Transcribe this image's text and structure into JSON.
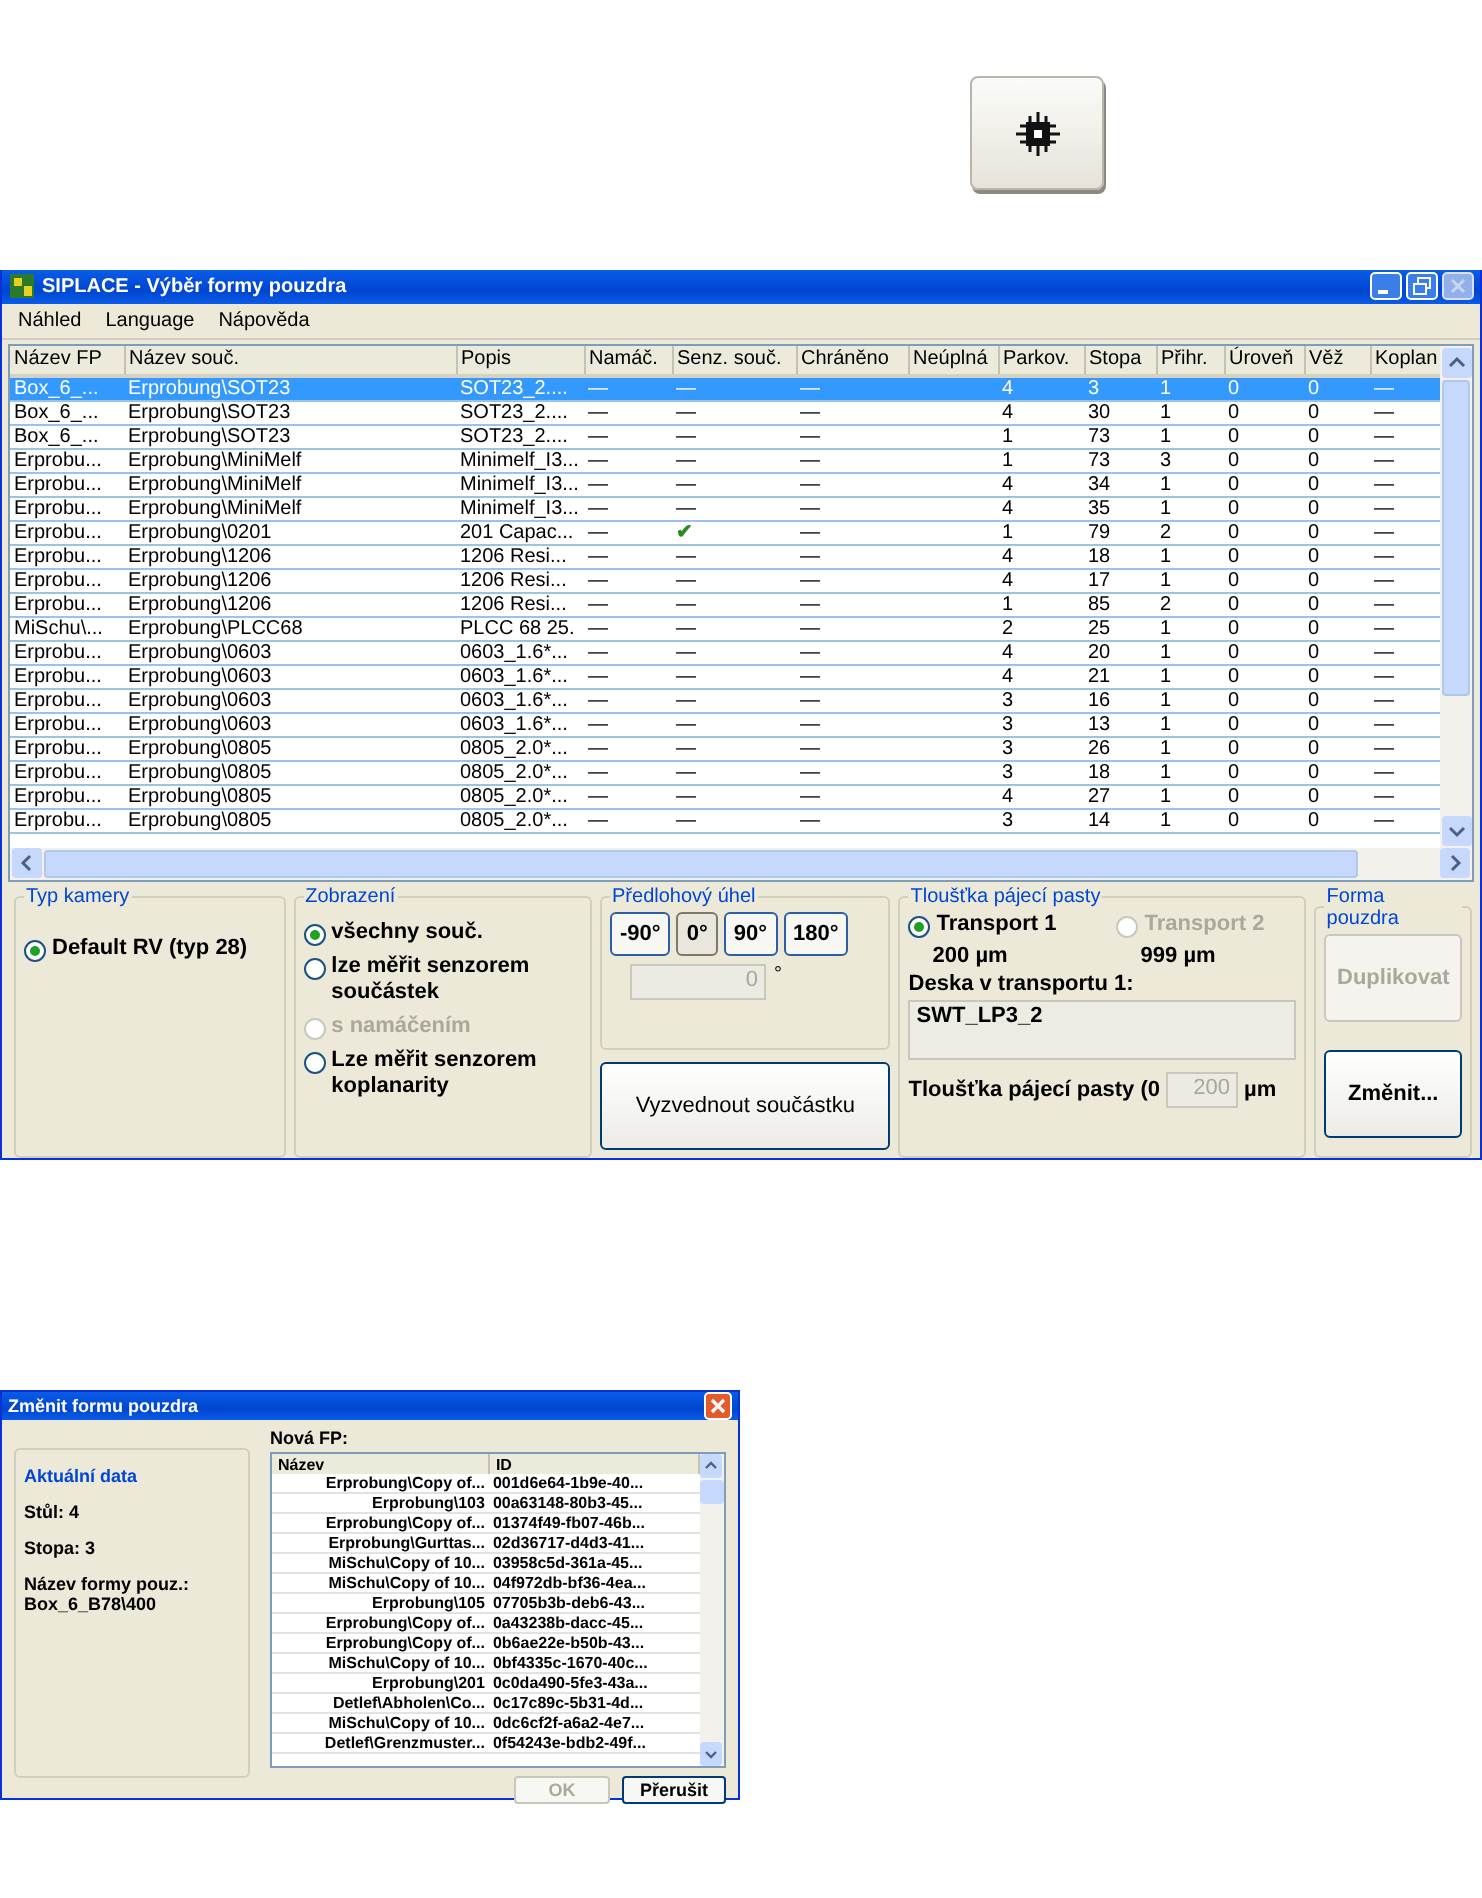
{
  "window": {
    "title": "SIPLACE - Výběr formy pouzdra"
  },
  "menu": [
    "Náhled",
    "Language",
    "Nápověda"
  ],
  "table": {
    "columns": [
      "Název FP",
      "Název souč.",
      "Popis",
      "Namáč.",
      "Senz. souč.",
      "Chráněno",
      "Neúplná",
      "Parkov.",
      "Stopa",
      "Přihr.",
      "Úroveň",
      "Věž",
      "Koplan"
    ],
    "rows": [
      {
        "selected": true,
        "sensor_ok": false,
        "cells": [
          "Box_6_...",
          "Erprobung\\SOT23",
          "SOT23_2....",
          "—",
          "—",
          "—",
          "",
          "4",
          "3",
          "1",
          "0",
          "0",
          "—"
        ]
      },
      {
        "selected": false,
        "sensor_ok": false,
        "cells": [
          "Box_6_...",
          "Erprobung\\SOT23",
          "SOT23_2....",
          "—",
          "—",
          "—",
          "",
          "4",
          "30",
          "1",
          "0",
          "0",
          "—"
        ]
      },
      {
        "selected": false,
        "sensor_ok": false,
        "cells": [
          "Box_6_...",
          "Erprobung\\SOT23",
          "SOT23_2....",
          "—",
          "—",
          "—",
          "",
          "1",
          "73",
          "1",
          "0",
          "0",
          "—"
        ]
      },
      {
        "selected": false,
        "sensor_ok": false,
        "cells": [
          "Erprobu...",
          "Erprobung\\MiniMelf",
          "Minimelf_I3...",
          "—",
          "—",
          "—",
          "",
          "1",
          "73",
          "3",
          "0",
          "0",
          "—"
        ]
      },
      {
        "selected": false,
        "sensor_ok": false,
        "cells": [
          "Erprobu...",
          "Erprobung\\MiniMelf",
          "Minimelf_I3...",
          "—",
          "—",
          "—",
          "",
          "4",
          "34",
          "1",
          "0",
          "0",
          "—"
        ]
      },
      {
        "selected": false,
        "sensor_ok": false,
        "cells": [
          "Erprobu...",
          "Erprobung\\MiniMelf",
          "Minimelf_I3...",
          "—",
          "—",
          "—",
          "",
          "4",
          "35",
          "1",
          "0",
          "0",
          "—"
        ]
      },
      {
        "selected": false,
        "sensor_ok": true,
        "cells": [
          "Erprobu...",
          "Erprobung\\0201",
          "201 Capac...",
          "—",
          "✔",
          "—",
          "",
          "1",
          "79",
          "2",
          "0",
          "0",
          "—"
        ]
      },
      {
        "selected": false,
        "sensor_ok": false,
        "cells": [
          "Erprobu...",
          "Erprobung\\1206",
          "1206 Resi...",
          "—",
          "—",
          "—",
          "",
          "4",
          "18",
          "1",
          "0",
          "0",
          "—"
        ]
      },
      {
        "selected": false,
        "sensor_ok": false,
        "cells": [
          "Erprobu...",
          "Erprobung\\1206",
          "1206 Resi...",
          "—",
          "—",
          "—",
          "",
          "4",
          "17",
          "1",
          "0",
          "0",
          "—"
        ]
      },
      {
        "selected": false,
        "sensor_ok": false,
        "cells": [
          "Erprobu...",
          "Erprobung\\1206",
          "1206 Resi...",
          "—",
          "—",
          "—",
          "",
          "1",
          "85",
          "2",
          "0",
          "0",
          "—"
        ]
      },
      {
        "selected": false,
        "sensor_ok": false,
        "cells": [
          "MiSchu\\...",
          "Erprobung\\PLCC68",
          "PLCC 68 25.",
          "—",
          "—",
          "—",
          "",
          "2",
          "25",
          "1",
          "0",
          "0",
          "—"
        ]
      },
      {
        "selected": false,
        "sensor_ok": false,
        "cells": [
          "Erprobu...",
          "Erprobung\\0603",
          "0603_1.6*...",
          "—",
          "—",
          "—",
          "",
          "4",
          "20",
          "1",
          "0",
          "0",
          "—"
        ]
      },
      {
        "selected": false,
        "sensor_ok": false,
        "cells": [
          "Erprobu...",
          "Erprobung\\0603",
          "0603_1.6*...",
          "—",
          "—",
          "—",
          "",
          "4",
          "21",
          "1",
          "0",
          "0",
          "—"
        ]
      },
      {
        "selected": false,
        "sensor_ok": false,
        "cells": [
          "Erprobu...",
          "Erprobung\\0603",
          "0603_1.6*...",
          "—",
          "—",
          "—",
          "",
          "3",
          "16",
          "1",
          "0",
          "0",
          "—"
        ]
      },
      {
        "selected": false,
        "sensor_ok": false,
        "cells": [
          "Erprobu...",
          "Erprobung\\0603",
          "0603_1.6*...",
          "—",
          "—",
          "—",
          "",
          "3",
          "13",
          "1",
          "0",
          "0",
          "—"
        ]
      },
      {
        "selected": false,
        "sensor_ok": false,
        "cells": [
          "Erprobu...",
          "Erprobung\\0805",
          "0805_2.0*...",
          "—",
          "—",
          "—",
          "",
          "3",
          "26",
          "1",
          "0",
          "0",
          "—"
        ]
      },
      {
        "selected": false,
        "sensor_ok": false,
        "cells": [
          "Erprobu...",
          "Erprobung\\0805",
          "0805_2.0*...",
          "—",
          "—",
          "—",
          "",
          "3",
          "18",
          "1",
          "0",
          "0",
          "—"
        ]
      },
      {
        "selected": false,
        "sensor_ok": false,
        "cells": [
          "Erprobu...",
          "Erprobung\\0805",
          "0805_2.0*...",
          "—",
          "—",
          "—",
          "",
          "4",
          "27",
          "1",
          "0",
          "0",
          "—"
        ]
      },
      {
        "selected": false,
        "sensor_ok": false,
        "cells": [
          "Erprobu...",
          "Erprobung\\0805",
          "0805_2.0*...",
          "—",
          "—",
          "—",
          "",
          "3",
          "14",
          "1",
          "0",
          "0",
          "—"
        ]
      }
    ]
  },
  "camera": {
    "title": "Typ kamery",
    "options": [
      {
        "label": "Default RV (typ 28)",
        "selected": true,
        "disabled": false
      }
    ]
  },
  "display": {
    "title": "Zobrazení",
    "options": [
      {
        "label": "všechny souč.",
        "selected": true,
        "disabled": false
      },
      {
        "label": "lze měřit senzorem součástek",
        "selected": false,
        "disabled": false
      },
      {
        "label": "s namáčením",
        "selected": false,
        "disabled": true
      },
      {
        "label": "Lze měřit senzorem koplanarity",
        "selected": false,
        "disabled": false
      }
    ]
  },
  "angle": {
    "title": "Předlohový úhel",
    "buttons": [
      {
        "label": "-90°",
        "selected": false
      },
      {
        "label": "0°",
        "selected": true
      },
      {
        "label": "90°",
        "selected": false
      },
      {
        "label": "180°",
        "selected": false
      }
    ],
    "value": "0",
    "unit": "°",
    "pick_button": "Vyzvednout součástku"
  },
  "paste": {
    "title": "Tloušťka pájecí pasty",
    "transports": [
      {
        "label": "Transport 1",
        "selected": true,
        "disabled": false,
        "value": "200 µm"
      },
      {
        "label": "Transport 2",
        "selected": false,
        "disabled": true,
        "value": "999 µm"
      }
    ],
    "board_label": "Deska v transportu 1:",
    "board_value": "SWT_LP3_2",
    "thickness_label": "Tloušťka pájecí pasty (0",
    "thickness_value": "200",
    "thickness_unit": "µm"
  },
  "package_form": {
    "title": "Forma pouzdra",
    "buttons": [
      {
        "label": "Duplikovat",
        "disabled": true
      },
      {
        "label": "Změnit...",
        "disabled": false
      }
    ]
  },
  "dialog": {
    "title": "Změnit formu pouzdra",
    "current": {
      "heading": "Aktuální data",
      "lines": [
        "Stůl: 4",
        "Stopa: 3"
      ],
      "form_label": "Název formy pouz.:",
      "form_value": "Box_6_B78\\400"
    },
    "new_label": "Nová FP:",
    "columns": [
      "Název",
      "ID"
    ],
    "rows": [
      [
        "Erprobung\\Copy of...",
        "001d6e64-1b9e-40..."
      ],
      [
        "Erprobung\\103",
        "00a63148-80b3-45..."
      ],
      [
        "Erprobung\\Copy of...",
        "01374f49-fb07-46b..."
      ],
      [
        "Erprobung\\Gurttas...",
        "02d36717-d4d3-41..."
      ],
      [
        "MiSchu\\Copy of 10...",
        "03958c5d-361a-45..."
      ],
      [
        "MiSchu\\Copy of 10...",
        "04f972db-bf36-4ea..."
      ],
      [
        "Erprobung\\105",
        "07705b3b-deb6-43..."
      ],
      [
        "Erprobung\\Copy of...",
        "0a43238b-dacc-45..."
      ],
      [
        "Erprobung\\Copy of...",
        "0b6ae22e-b50b-43..."
      ],
      [
        "MiSchu\\Copy of 10...",
        "0bf4335c-1670-40c..."
      ],
      [
        "Erprobung\\201",
        "0c0da490-5fe3-43a..."
      ],
      [
        "Detlef\\Abholen\\Co...",
        "0c17c89c-5b31-4d..."
      ],
      [
        "MiSchu\\Copy of 10...",
        "0dc6cf2f-a6a2-4e7..."
      ],
      [
        "Detlef\\Grenzmuster...",
        "0f54243e-bdb2-49f..."
      ]
    ],
    "buttons": [
      {
        "label": "OK",
        "disabled": true
      },
      {
        "label": "Přerušit",
        "disabled": false
      }
    ]
  }
}
